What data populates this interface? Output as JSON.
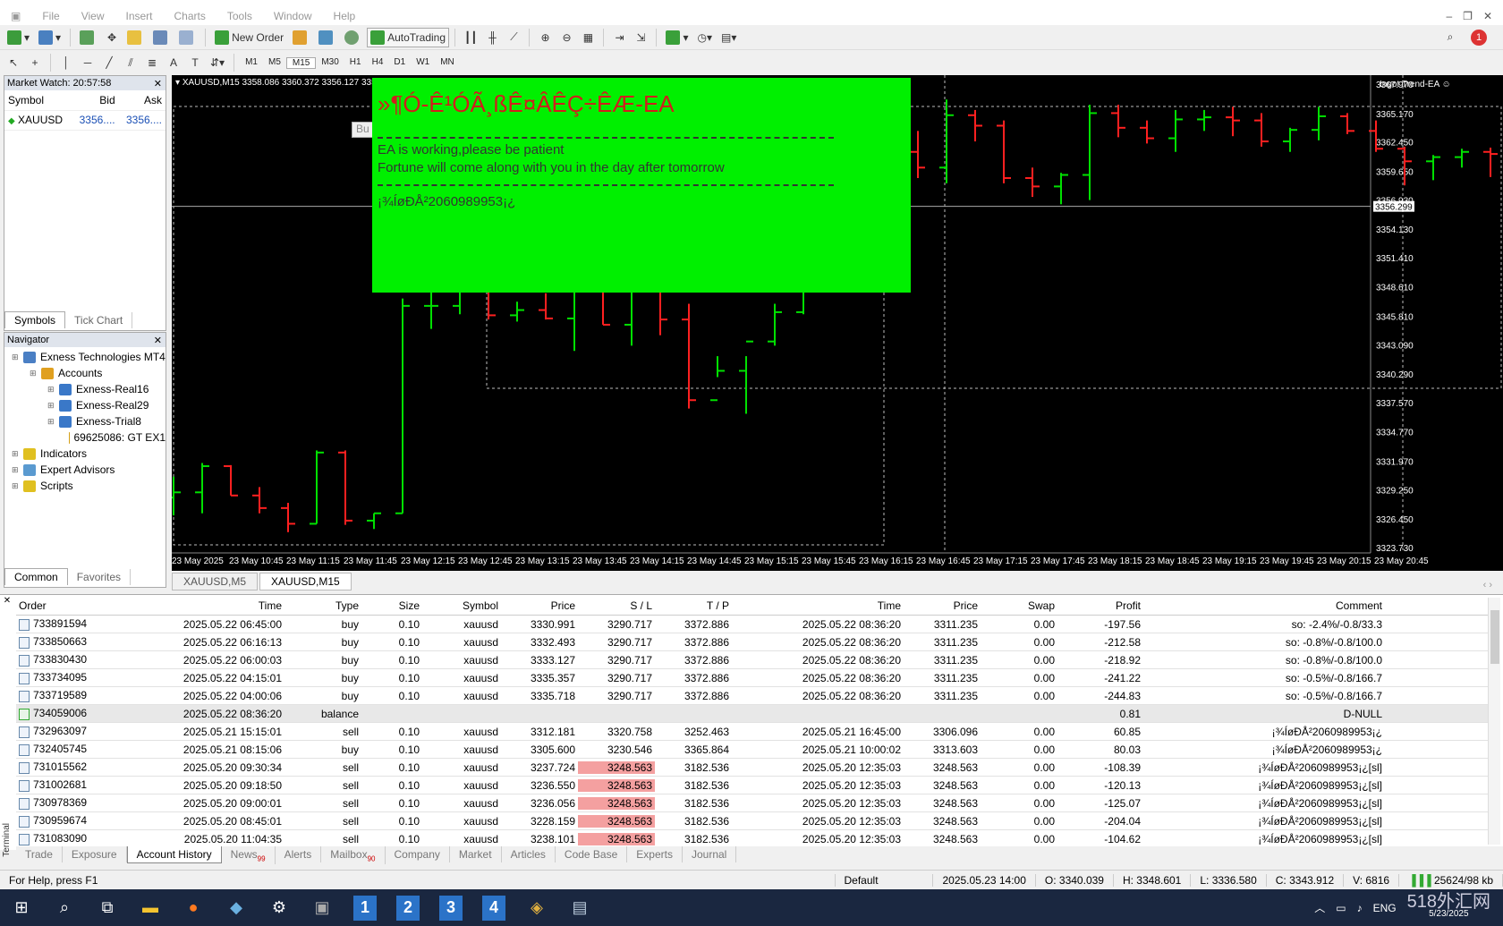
{
  "menu": [
    "File",
    "View",
    "Insert",
    "Charts",
    "Tools",
    "Window",
    "Help"
  ],
  "toolbar": {
    "new_order": "New Order",
    "autotrading": "AutoTrading"
  },
  "timeframes": [
    "M1",
    "M5",
    "M15",
    "M30",
    "H1",
    "H4",
    "D1",
    "W1",
    "MN"
  ],
  "active_timeframe": "M15",
  "market_watch": {
    "title": "Market Watch: 20:57:58",
    "headers": [
      "Symbol",
      "Bid",
      "Ask"
    ],
    "rows": [
      {
        "symbol": "XAUUSD",
        "bid": "3356....",
        "ask": "3356...."
      }
    ],
    "tabs": [
      "Symbols",
      "Tick Chart"
    ]
  },
  "navigator": {
    "title": "Navigator",
    "items": [
      {
        "label": "Exness Technologies MT4",
        "level": 0,
        "icon": "terminal-icon",
        "color": "#4a7fc4"
      },
      {
        "label": "Accounts",
        "level": 1,
        "icon": "accounts-icon",
        "color": "#e0a020"
      },
      {
        "label": "Exness-Real16",
        "level": 2,
        "icon": "account-icon",
        "color": "#3a78c8"
      },
      {
        "label": "Exness-Real29",
        "level": 2,
        "icon": "account-icon",
        "color": "#3a78c8"
      },
      {
        "label": "Exness-Trial8",
        "level": 2,
        "icon": "account-icon",
        "color": "#3a78c8"
      },
      {
        "label": "69625086: GT EX1",
        "level": 3,
        "icon": "user-icon",
        "color": "#d4a017"
      },
      {
        "label": "Indicators",
        "level": 0,
        "icon": "indicators-icon",
        "color": "#e0c020"
      },
      {
        "label": "Expert Advisors",
        "level": 0,
        "icon": "expert-advisors-icon",
        "color": "#5a9ad0"
      },
      {
        "label": "Scripts",
        "level": 0,
        "icon": "scripts-icon",
        "color": "#e0c020"
      }
    ],
    "tabs": [
      "Common",
      "Favorites"
    ]
  },
  "chart": {
    "info": "XAUUSD,M15  3358.086 3360.372 3356.127 3356",
    "ea_name": "Ingot Trend-EA ☺",
    "button_stub": "Bu",
    "price_labels": [
      "3367.970",
      "3365.170",
      "3362.450",
      "3359.650",
      "3356.930",
      "3354.130",
      "3351.410",
      "3348.610",
      "3345.810",
      "3343.090",
      "3340.290",
      "3337.570",
      "3334.770",
      "3331.970",
      "3329.250",
      "3326.450",
      "3323.730"
    ],
    "current_price": "3356.299",
    "time_labels": [
      "23 May 2025",
      "23 May 10:45",
      "23 May 11:15",
      "23 May 11:45",
      "23 May 12:15",
      "23 May 12:45",
      "23 May 13:15",
      "23 May 13:45",
      "23 May 14:15",
      "23 May 14:45",
      "23 May 15:15",
      "23 May 15:45",
      "23 May 16:15",
      "23 May 16:45",
      "23 May 17:15",
      "23 May 17:45",
      "23 May 18:15",
      "23 May 18:45",
      "23 May 19:15",
      "23 May 19:45",
      "23 May 20:15",
      "23 May 20:45"
    ],
    "ea_panel": {
      "title": "»¶Ó-Ê¹ÓÃ¸ßÊ¤ÂÊÇ÷ÊÆ-EA",
      "line1": "EA is working,please be patient",
      "line2": "Fortune will come along with you in the day after tomorrow",
      "line3": "¡¾ÍøÐÅ²2060989953¡¿",
      "bg": "#00f000",
      "title_color": "#d21d1d"
    }
  },
  "chart_tabs": [
    "XAUUSD,M5",
    "XAUUSD,M15"
  ],
  "terminal": {
    "headers": [
      "Order",
      "Time",
      "Type",
      "Size",
      "Symbol",
      "Price",
      "S / L",
      "T / P",
      "Time",
      "Price",
      "Swap",
      "Profit",
      "Comment"
    ],
    "rows": [
      [
        "733891594",
        "2025.05.22 06:45:00",
        "buy",
        "0.10",
        "xauusd",
        "3330.991",
        "3290.717",
        "3372.886",
        "2025.05.22 08:36:20",
        "3311.235",
        "0.00",
        "-197.56",
        "so: -2.4%/-0.8/33.3"
      ],
      [
        "733850663",
        "2025.05.22 06:16:13",
        "buy",
        "0.10",
        "xauusd",
        "3332.493",
        "3290.717",
        "3372.886",
        "2025.05.22 08:36:20",
        "3311.235",
        "0.00",
        "-212.58",
        "so: -0.8%/-0.8/100.0"
      ],
      [
        "733830430",
        "2025.05.22 06:00:03",
        "buy",
        "0.10",
        "xauusd",
        "3333.127",
        "3290.717",
        "3372.886",
        "2025.05.22 08:36:20",
        "3311.235",
        "0.00",
        "-218.92",
        "so: -0.8%/-0.8/100.0"
      ],
      [
        "733734095",
        "2025.05.22 04:15:01",
        "buy",
        "0.10",
        "xauusd",
        "3335.357",
        "3290.717",
        "3372.886",
        "2025.05.22 08:36:20",
        "3311.235",
        "0.00",
        "-241.22",
        "so: -0.5%/-0.8/166.7"
      ],
      [
        "733719589",
        "2025.05.22 04:00:06",
        "buy",
        "0.10",
        "xauusd",
        "3335.718",
        "3290.717",
        "3372.886",
        "2025.05.22 08:36:20",
        "3311.235",
        "0.00",
        "-244.83",
        "so: -0.5%/-0.8/166.7"
      ],
      [
        "734059006",
        "2025.05.22 08:36:20",
        "balance",
        "",
        "",
        "",
        "",
        "",
        "",
        "",
        "",
        "0.81",
        "D-NULL"
      ],
      [
        "732963097",
        "2025.05.21 15:15:01",
        "sell",
        "0.10",
        "xauusd",
        "3312.181",
        "3320.758",
        "3252.463",
        "2025.05.21 16:45:00",
        "3306.096",
        "0.00",
        "60.85",
        "¡¾ÍøÐÅ²2060989953¡¿"
      ],
      [
        "732405745",
        "2025.05.21 08:15:06",
        "buy",
        "0.10",
        "xauusd",
        "3305.600",
        "3230.546",
        "3365.864",
        "2025.05.21 10:00:02",
        "3313.603",
        "0.00",
        "80.03",
        "¡¾ÍøÐÅ²2060989953¡¿"
      ],
      [
        "731015562",
        "2025.05.20 09:30:34",
        "sell",
        "0.10",
        "xauusd",
        "3237.724",
        "3248.563",
        "3182.536",
        "2025.05.20 12:35:03",
        "3248.563",
        "0.00",
        "-108.39",
        "¡¾ÍøÐÅ²2060989953¡¿[sl]"
      ],
      [
        "731002681",
        "2025.05.20 09:18:50",
        "sell",
        "0.10",
        "xauusd",
        "3236.550",
        "3248.563",
        "3182.536",
        "2025.05.20 12:35:03",
        "3248.563",
        "0.00",
        "-120.13",
        "¡¾ÍøÐÅ²2060989953¡¿[sl]"
      ],
      [
        "730978369",
        "2025.05.20 09:00:01",
        "sell",
        "0.10",
        "xauusd",
        "3236.056",
        "3248.563",
        "3182.536",
        "2025.05.20 12:35:03",
        "3248.563",
        "0.00",
        "-125.07",
        "¡¾ÍøÐÅ²2060989953¡¿[sl]"
      ],
      [
        "730959674",
        "2025.05.20 08:45:01",
        "sell",
        "0.10",
        "xauusd",
        "3228.159",
        "3248.563",
        "3182.536",
        "2025.05.20 12:35:03",
        "3248.563",
        "0.00",
        "-204.04",
        "¡¾ÍøÐÅ²2060989953¡¿[sl]"
      ],
      [
        "731083090",
        "2025.05.20 11:04:35",
        "sell",
        "0.10",
        "xauusd",
        "3238.101",
        "3248.563",
        "3182.536",
        "2025.05.20 12:35:03",
        "3248.563",
        "0.00",
        "-104.62",
        "¡¾ÍøÐÅ²2060989953¡¿[sl]"
      ]
    ],
    "sl_hit_rows": [
      8,
      9,
      10,
      11,
      12
    ],
    "tabs": [
      {
        "label": "Trade"
      },
      {
        "label": "Exposure"
      },
      {
        "label": "Account History",
        "active": true
      },
      {
        "label": "News",
        "badge": "99"
      },
      {
        "label": "Alerts"
      },
      {
        "label": "Mailbox",
        "badge": "90"
      },
      {
        "label": "Company"
      },
      {
        "label": "Market"
      },
      {
        "label": "Articles"
      },
      {
        "label": "Code Base"
      },
      {
        "label": "Experts"
      },
      {
        "label": "Journal"
      }
    ],
    "side_label": "Terminal"
  },
  "status": {
    "help": "For Help, press F1",
    "profile": "Default",
    "datetime": "2025.05.23 14:00",
    "open": "O: 3340.039",
    "high": "H: 3348.601",
    "low": "L: 3336.580",
    "close": "C: 3343.912",
    "volume": "V: 6816",
    "traffic": "25624/98 kb"
  },
  "taskbar": {
    "numbers": [
      "1",
      "2",
      "3",
      "4"
    ],
    "lang": "ENG",
    "watermark": "518外汇网",
    "date": "5/23/2025"
  },
  "colors": {
    "bull": "#00e000",
    "bear": "#ff2020",
    "sl_hit": "#f4a0a0"
  }
}
